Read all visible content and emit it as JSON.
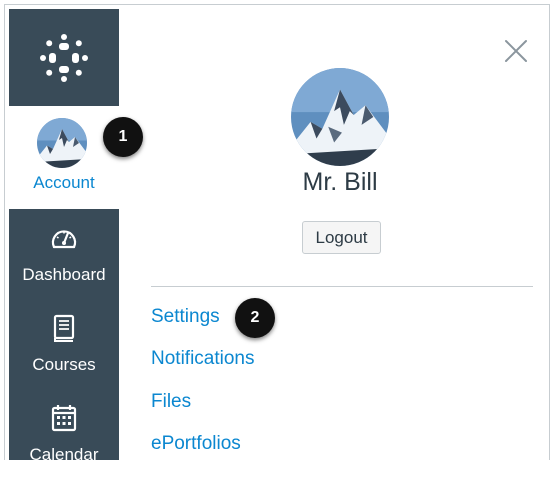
{
  "nav": {
    "logo_icon": "canvas-logo-icon",
    "account": {
      "label": "Account",
      "icon": "user-avatar"
    },
    "items": [
      {
        "label": "Dashboard",
        "icon": "dashboard-gauge-icon"
      },
      {
        "label": "Courses",
        "icon": "book-icon"
      },
      {
        "label": "Calendar",
        "icon": "calendar-icon"
      }
    ]
  },
  "callouts": {
    "first": "1",
    "second": "2"
  },
  "tray": {
    "close_icon": "close-icon",
    "user_name": "Mr. Bill",
    "logout_label": "Logout",
    "links": [
      {
        "label": "Settings"
      },
      {
        "label": "Notifications"
      },
      {
        "label": "Files"
      },
      {
        "label": "ePortfolios"
      }
    ]
  },
  "colors": {
    "nav_background": "#394b58",
    "link": "#0b87d0",
    "text": "#2d3b45",
    "callout": "#111111"
  }
}
